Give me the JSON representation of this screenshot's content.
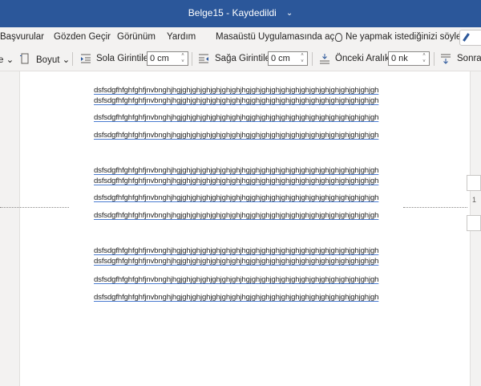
{
  "titlebar": {
    "title": "Belge15 - Kaydedildi",
    "chevron": "⌄"
  },
  "menu": {
    "references": "Başvurular",
    "review": "Gözden Geçir",
    "view": "Görünüm",
    "help": "Yardım",
    "open_desktop": "Masaüstü Uygulamasında aç",
    "tell_me": "Ne yapmak istediğinizi söyley"
  },
  "toolbar": {
    "style_chevron": "e ⌄",
    "size_label": "Boyut ⌄",
    "left_indent_label": "Sola Girintile",
    "left_indent_value": "0 cm",
    "right_indent_label": "Sağa Girintile",
    "right_indent_value": "0 cm",
    "spacing_before_label": "Önceki Aralık",
    "spacing_before_value": "0 nk",
    "spacing_after_label": "Sonrak"
  },
  "document": {
    "lines": [
      "dsfsdgfhfghfghfjnvbnghjhgjghjghjghjghjghjghjhgjghjghjghjghjghjghjghjghjghjghjghjghjgh",
      "dsfsdgfhfghfghfjnvbnghjhgjghjghjghjghjghjghjhgjghjghjghjghjghjghjghjghjghjghjghjghjgh",
      "dsfsdgfhfghfghfjnvbnghjhgjghjghjghjghjghjghjhgjghjghjghjghjghjghjghjghjghjghjghjghjgh",
      "dsfsdgfhfghfghfjnvbnghjhgjghjghjghjghjghjghjhgjghjghjghjghjghjghjghjghjghjghjghjghjgh",
      "dsfsdgfhfghfghfjnvbnghjhgjghjghjghjghjghjghjhgjghjghjghjghjghjghjghjghjghjghjghjghjgh",
      "dsfsdgfhfghfghfjnvbnghjhgjghjghjghjghjghjghjhgjghjghjghjghjghjghjghjghjghjghjghjghjgh",
      "dsfsdgfhfghfghfjnvbnghjhgjghjghjghjghjghjghjhgjghjghjghjghjghjghjghjghjghjghjghjghjgh",
      "dsfsdgfhfghfghfjnvbnghjhgjghjghjghjghjghjghjhgjghjghjghjghjghjghjghjghjghjghjghjghjgh",
      "dsfsdgfhfghfghfjnvbnghjhgjghjghjghjghjghjghjhgjghjghjghjghjghjghjghjghjghjghjghjghjgh",
      "dsfsdgfhfghfghfjnvbnghjhgjghjghjghjghjghjghjhgjghjghjghjghjghjghjghjghjghjghjghjghjgh",
      "dsfsdgfhfghfghfjnvbnghjhgjghjghjghjghjghjghjhgjghjghjghjghjghjghjghjghjghjghjghjghjgh",
      "dsfsdgfhfghfghfjnvbnghjhgjghjghjghjghjghjghjhgjghjghjghjghjghjghjghjghjghjghjghjghjgh"
    ],
    "page_indicator": "1"
  }
}
